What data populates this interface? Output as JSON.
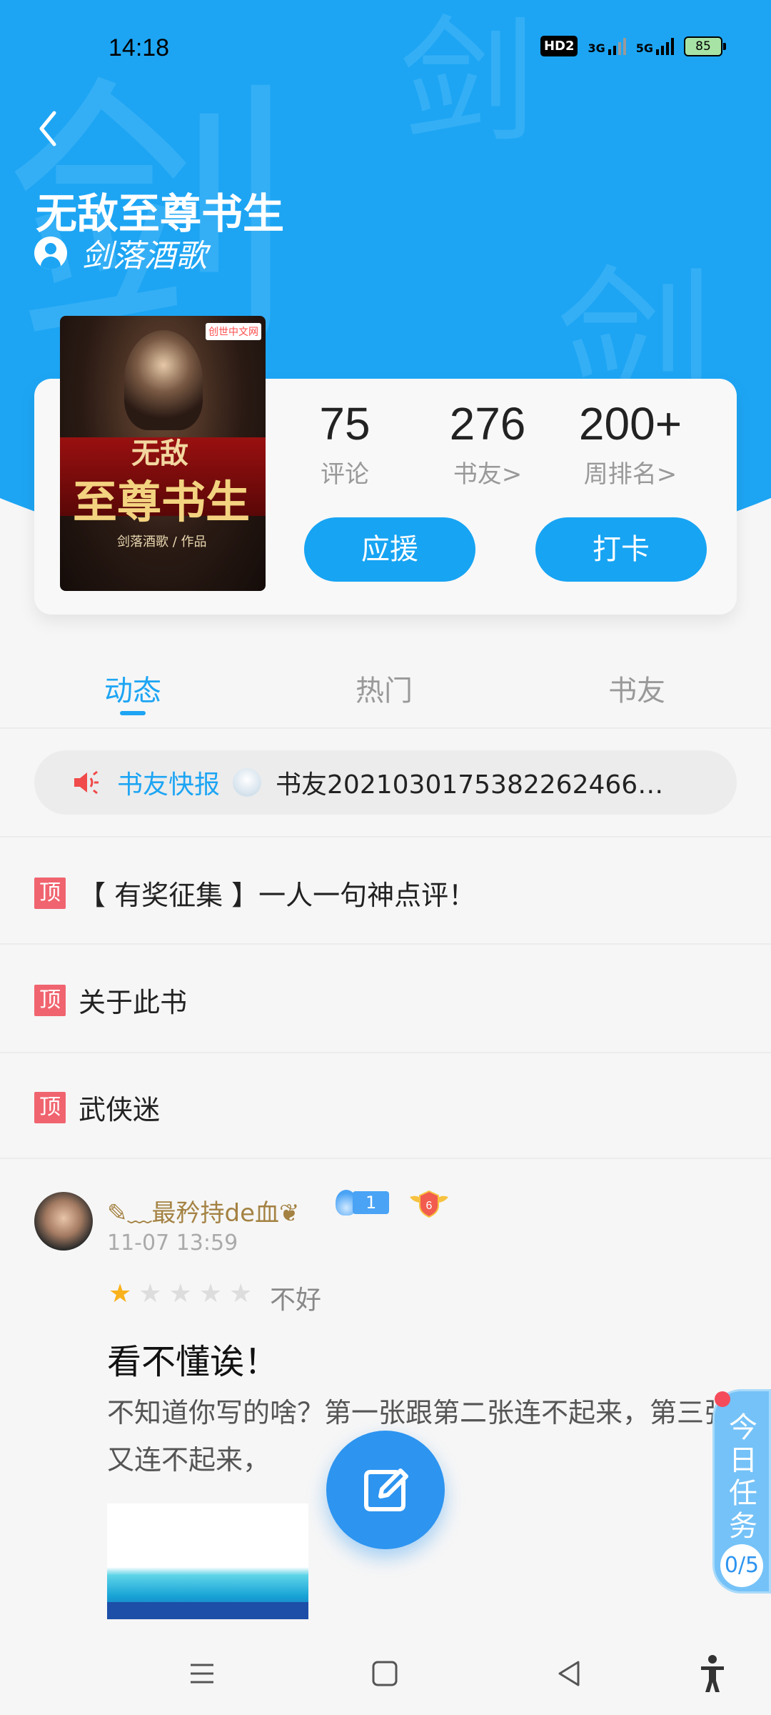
{
  "status_bar": {
    "time": "14:18",
    "hd": "HD2",
    "net1": "3G",
    "net2": "5G",
    "battery": "85"
  },
  "header": {
    "watermark_glyph": "剑",
    "book_title": "无敌至尊书生",
    "author": "剑落酒歌"
  },
  "cover": {
    "line1": "无敌",
    "line2": "至尊书生",
    "line3": "剑落酒歌 / 作品",
    "logo": "创世中文网"
  },
  "stats": [
    {
      "value": "75",
      "label": "评论"
    },
    {
      "value": "276",
      "label": "书友>"
    },
    {
      "value": "200+",
      "label": "周排名>"
    }
  ],
  "buttons": {
    "support": "应援",
    "checkin": "打卡"
  },
  "tabs": [
    {
      "label": "动态"
    },
    {
      "label": "热门"
    },
    {
      "label": "书友"
    }
  ],
  "news": {
    "label": "书友快报",
    "text": "书友20210301753822624​66…"
  },
  "pinned": [
    {
      "tag": "顶",
      "text": "【 有奖征集 】一人一句神点评！"
    },
    {
      "tag": "顶",
      "text": "关于此书"
    },
    {
      "tag": "顶",
      "text": "武侠迷"
    }
  ],
  "post": {
    "username": "✎﹏最矜持de血❦",
    "level": "1",
    "shield_level": "6",
    "time": "11-07 13:59",
    "rating": 1,
    "rating_max": 5,
    "rating_word": "不好",
    "title": "看不懂诶！",
    "body": "不知道你写的啥？第一张跟第二张连不起来，第三张又连不起来，"
  },
  "task": {
    "label": "今日任务",
    "count": "0/5"
  },
  "colors": {
    "brand": "#1da5f4",
    "pin": "#f0646f",
    "star": "#f9b21c"
  }
}
